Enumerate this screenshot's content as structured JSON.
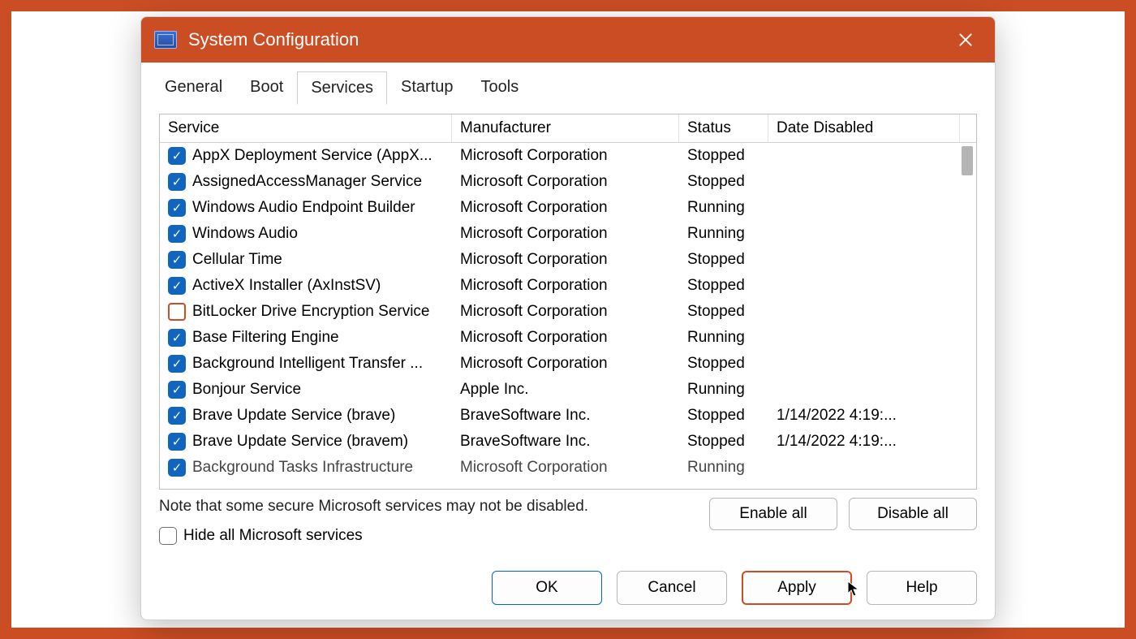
{
  "window": {
    "title": "System Configuration"
  },
  "tabs": [
    "General",
    "Boot",
    "Services",
    "Startup",
    "Tools"
  ],
  "active_tab": "Services",
  "columns": [
    "Service",
    "Manufacturer",
    "Status",
    "Date Disabled"
  ],
  "rows": [
    {
      "checked": true,
      "service": "AppX Deployment Service (AppX...",
      "manufacturer": "Microsoft Corporation",
      "status": "Stopped",
      "date": ""
    },
    {
      "checked": true,
      "service": "AssignedAccessManager Service",
      "manufacturer": "Microsoft Corporation",
      "status": "Stopped",
      "date": ""
    },
    {
      "checked": true,
      "service": "Windows Audio Endpoint Builder",
      "manufacturer": "Microsoft Corporation",
      "status": "Running",
      "date": ""
    },
    {
      "checked": true,
      "service": "Windows Audio",
      "manufacturer": "Microsoft Corporation",
      "status": "Running",
      "date": ""
    },
    {
      "checked": true,
      "service": "Cellular Time",
      "manufacturer": "Microsoft Corporation",
      "status": "Stopped",
      "date": ""
    },
    {
      "checked": true,
      "service": "ActiveX Installer (AxInstSV)",
      "manufacturer": "Microsoft Corporation",
      "status": "Stopped",
      "date": ""
    },
    {
      "checked": false,
      "service": "BitLocker Drive Encryption Service",
      "manufacturer": "Microsoft Corporation",
      "status": "Stopped",
      "date": ""
    },
    {
      "checked": true,
      "service": "Base Filtering Engine",
      "manufacturer": "Microsoft Corporation",
      "status": "Running",
      "date": ""
    },
    {
      "checked": true,
      "service": "Background Intelligent Transfer ...",
      "manufacturer": "Microsoft Corporation",
      "status": "Stopped",
      "date": ""
    },
    {
      "checked": true,
      "service": "Bonjour Service",
      "manufacturer": "Apple Inc.",
      "status": "Running",
      "date": ""
    },
    {
      "checked": true,
      "service": "Brave Update Service (brave)",
      "manufacturer": "BraveSoftware Inc.",
      "status": "Stopped",
      "date": "1/14/2022 4:19:..."
    },
    {
      "checked": true,
      "service": "Brave Update Service (bravem)",
      "manufacturer": "BraveSoftware Inc.",
      "status": "Stopped",
      "date": "1/14/2022 4:19:..."
    },
    {
      "checked": true,
      "service": "Background Tasks Infrastructure",
      "manufacturer": "Microsoft Corporation",
      "status": "Running",
      "date": "",
      "partial": true
    }
  ],
  "note": "Note that some secure Microsoft services may not be disabled.",
  "hide_label": "Hide all Microsoft services",
  "buttons": {
    "enable_all": "Enable all",
    "disable_all": "Disable all",
    "ok": "OK",
    "cancel": "Cancel",
    "apply": "Apply",
    "help": "Help"
  }
}
